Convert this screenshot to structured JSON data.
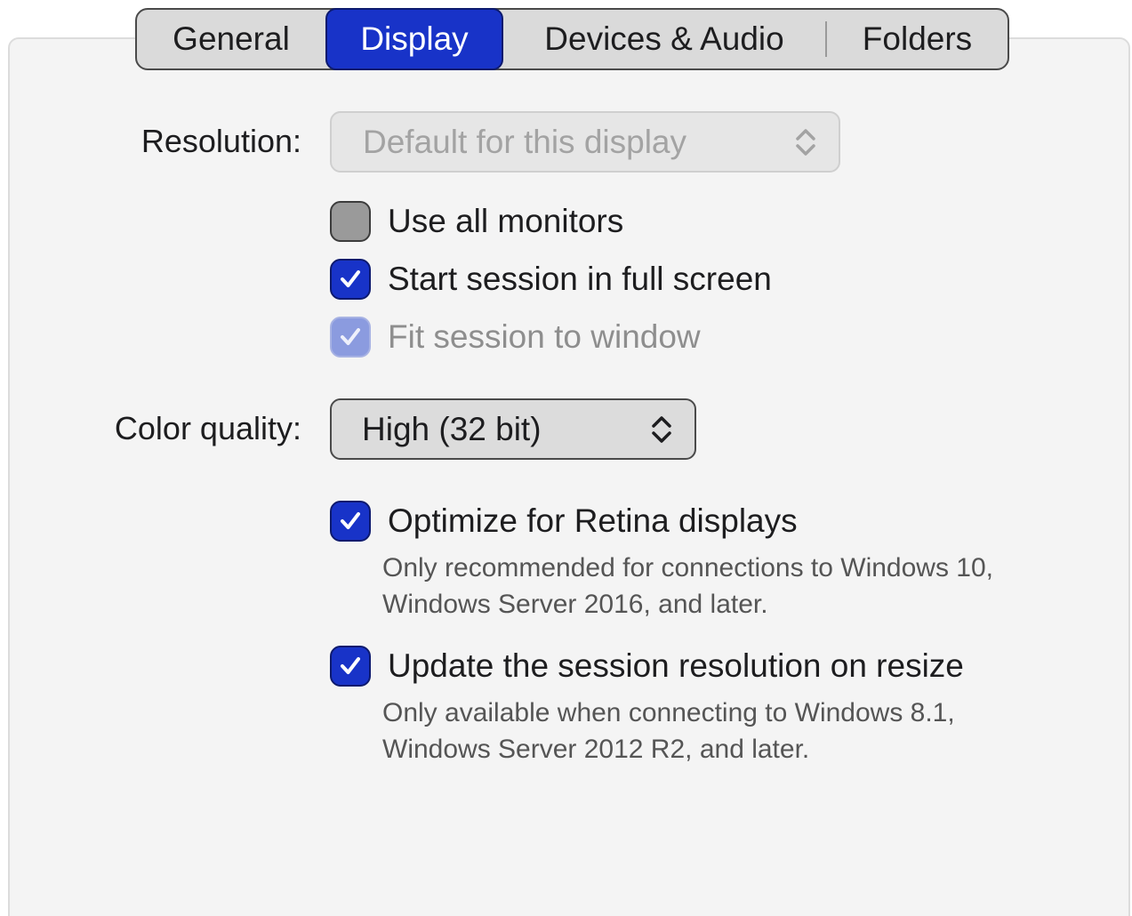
{
  "tabs": [
    {
      "label": "General",
      "selected": false
    },
    {
      "label": "Display",
      "selected": true
    },
    {
      "label": "Devices & Audio",
      "selected": false
    },
    {
      "label": "Folders",
      "selected": false
    }
  ],
  "resolution": {
    "label": "Resolution:",
    "value": "Default for this display",
    "enabled": false,
    "icon": "chevron-up-down-icon"
  },
  "options": {
    "use_all_monitors": {
      "label": "Use all monitors",
      "checked": false,
      "enabled": true
    },
    "full_screen": {
      "label": "Start session in full screen",
      "checked": true,
      "enabled": true
    },
    "fit_to_window": {
      "label": "Fit session to window",
      "checked": true,
      "enabled": false
    }
  },
  "color_quality": {
    "label": "Color quality:",
    "value": "High (32 bit)",
    "icon": "chevron-up-down-icon"
  },
  "retina": {
    "label": "Optimize for Retina displays",
    "checked": true,
    "help": "Only recommended for connections to Windows 10, Windows Server 2016, and later."
  },
  "resize": {
    "label": "Update the session resolution on resize",
    "checked": true,
    "help": "Only available when connecting to Windows 8.1, Windows Server 2012 R2, and later."
  },
  "colors": {
    "accent": "#1833c8",
    "panel_bg": "#f4f4f4"
  }
}
